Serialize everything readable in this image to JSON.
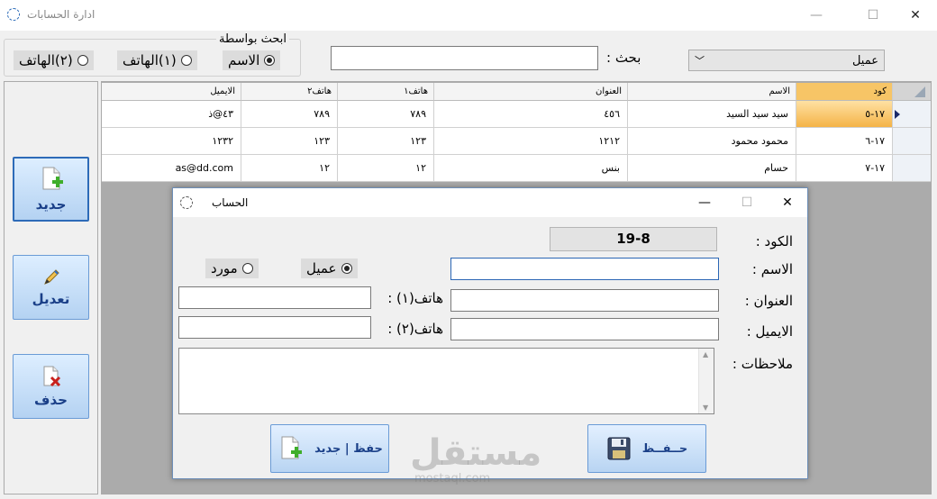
{
  "window": {
    "title": "ادارة الحسابات",
    "min": "—",
    "max": "☐",
    "close": "✕"
  },
  "search_by": {
    "legend": "ابحث بواسطة",
    "options": [
      {
        "label": "الاسم",
        "selected": true
      },
      {
        "label": "(١)الهاتف",
        "selected": false
      },
      {
        "label": "(٢)الهاتف",
        "selected": false
      }
    ]
  },
  "search": {
    "label": "بحث :",
    "value": ""
  },
  "type_select": {
    "value": "عميل",
    "arrow": "﹀"
  },
  "sidebar": {
    "new": "جديد",
    "edit": "تعديل",
    "delete": "حذف"
  },
  "grid": {
    "columns": [
      "كود",
      "الاسم",
      "العنوان",
      "هاتف١",
      "هاتف٢",
      "الايميل"
    ],
    "rows": [
      {
        "code": "١٧-٥",
        "name": "سيد سيد السيد",
        "address": "٤٥٦",
        "phone1": "٧٨٩",
        "phone2": "٧٨٩",
        "email": "٤٣@ذ"
      },
      {
        "code": "١٧-٦",
        "name": "محمود محمود",
        "address": "١٢١٢",
        "phone1": "١٢٣",
        "phone2": "١٢٣",
        "email": "١٢٣٢"
      },
      {
        "code": "١٧-٧",
        "name": "حسام",
        "address": "بنس",
        "phone1": "١٢",
        "phone2": "١٢",
        "email": "as@dd.com"
      }
    ]
  },
  "dialog": {
    "title": "الحساب",
    "min": "—",
    "max": "☐",
    "close": "✕",
    "code_label": "الكود :",
    "code_value": "19-8",
    "name_label": "الاسم :",
    "name_value": "",
    "address_label": "العنوان :",
    "email_label": "الايميل :",
    "notes_label": "ملاحظات :",
    "phone1_label": "هاتف(١) :",
    "phone2_label": "هاتف(٢) :",
    "type_options": [
      {
        "label": "عميل",
        "selected": true
      },
      {
        "label": "مورد",
        "selected": false
      }
    ],
    "save_label": "حــفــظ",
    "save_new_label": "حفظ | جديد"
  },
  "watermark": {
    "text": "مستقل",
    "sub": "mostaql.com"
  }
}
